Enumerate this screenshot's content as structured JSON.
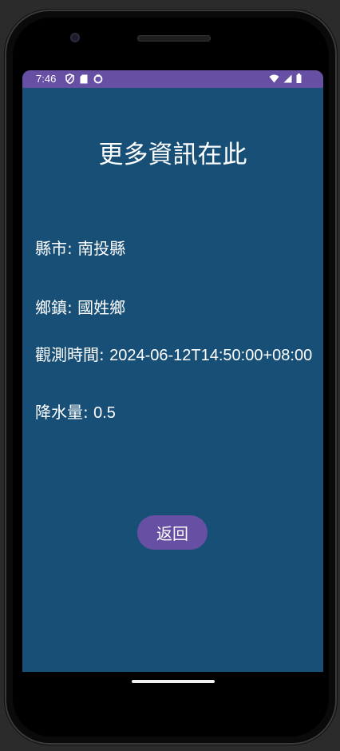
{
  "status_bar": {
    "time": "7:46",
    "accent_color": "#6750a4",
    "left_icons": [
      "vpn-shield-icon",
      "sd-card-icon",
      "sync-icon"
    ],
    "right_icons": [
      "wifi-icon",
      "cellular-signal-icon",
      "battery-icon"
    ]
  },
  "page": {
    "title": "更多資訊在此",
    "background_color": "#174f77"
  },
  "info": {
    "county_label": "縣市: ",
    "county_value": "南投縣",
    "town_label": "鄉鎮: ",
    "town_value": "國姓鄉",
    "obs_time_label": "觀測時間: ",
    "obs_time_value": "2024-06-12T14:50:00+08:00",
    "precip_label": "降水量: ",
    "precip_value": "0.5"
  },
  "actions": {
    "back_label": "返回"
  }
}
